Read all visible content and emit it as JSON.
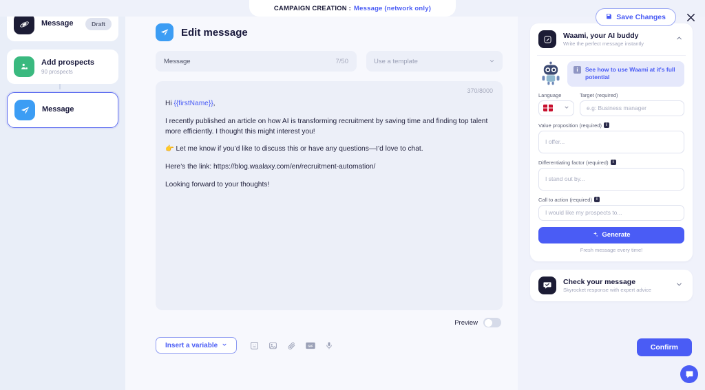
{
  "header": {
    "breadcrumb_label": "CAMPAIGN CREATION :",
    "breadcrumb_value": "Message (network only)",
    "save_label": "Save Changes",
    "close_label": "✕"
  },
  "sidebar": {
    "steps": [
      {
        "title": "Message",
        "sub": "",
        "badge": "Draft",
        "icon": "planet-icon",
        "selected": false
      },
      {
        "title": "Add prospects",
        "sub": "90 prospects",
        "badge": "",
        "icon": "prospects-icon",
        "selected": false
      },
      {
        "title": "Message",
        "sub": "",
        "badge": "",
        "icon": "send-icon",
        "selected": true
      }
    ]
  },
  "main": {
    "title": "Edit message",
    "message_field_label": "Message",
    "message_field_count": "7/50",
    "template_placeholder": "Use a template",
    "editor_count": "370/8000",
    "editor_lines": [
      {
        "prefix": "Hi ",
        "variable": "{{firstName}}",
        "suffix": ","
      },
      {
        "prefix": "I recently published an article on how AI is transforming recruitment by saving time and finding top talent more efficiently. I thought this might interest you!",
        "variable": "",
        "suffix": ""
      },
      {
        "prefix": "👉 Let me know if you’d like to discuss this or have any questions—I’d love to chat.",
        "variable": "",
        "suffix": ""
      },
      {
        "prefix": "Here’s the link: https://blog.waalaxy.com/en/recruitment-automation/",
        "variable": "",
        "suffix": ""
      },
      {
        "prefix": "Looking forward to your thoughts!",
        "variable": "",
        "suffix": ""
      }
    ],
    "preview_label": "Preview",
    "preview_on": false,
    "insert_variable_label": "Insert a variable",
    "tool_icons": [
      "emoji-icon",
      "image-icon",
      "attachment-icon",
      "gif-icon",
      "voice-icon"
    ]
  },
  "right_panel": {
    "waami": {
      "title": "Waami, your AI buddy",
      "subtitle": "Write the perfect message instantly",
      "collapse_chevron": "⌃",
      "tip_text": "See how to use Waami at it's full potential",
      "tip_icon": "info-icon",
      "language_label": "Language",
      "language_flag": "uk-flag-icon",
      "target_label": "Target (required)",
      "target_placeholder": "e.g: Business manager",
      "value_prop_label": "Value proposition (required)",
      "value_prop_placeholder": "I offer...",
      "diff_label": "Differentiating factor (required)",
      "diff_placeholder": "I stand out by...",
      "cta_label": "Call to action (required)",
      "cta_placeholder": "I would like my prospects to...",
      "generate_label": "Generate",
      "generate_note": "Fresh message every time!"
    },
    "check": {
      "title": "Check your message",
      "subtitle": "Skyrocket response with expert advice",
      "expand_chevron": "⌄"
    }
  },
  "footer": {
    "confirm_label": "Confirm",
    "chat_icon": "chat-widget-icon"
  },
  "colors": {
    "accent": "#4a5cf5",
    "dark": "#1c1c35",
    "page_bg": "#eef1fa",
    "sidebar_bg": "#e9eef8",
    "main_bg": "#f7f8fd",
    "right_bg": "#f0f2fb",
    "field_bg": "#eceff8",
    "green": "#3ab97f",
    "blue": "#3c9df4"
  }
}
